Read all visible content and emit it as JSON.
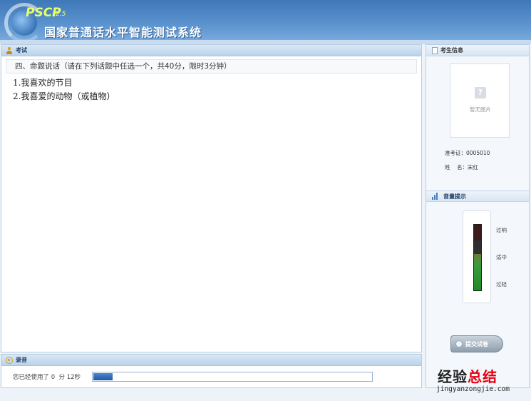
{
  "header": {
    "logo": "PSCP",
    "logo_version": "2.5",
    "title": "国家普通话水平智能测试系统"
  },
  "exam": {
    "tab_label": "考试",
    "section_title": "四、命题说话（请在下列话题中任选一个，共40分，限时3分钟）",
    "topics": [
      "1.我喜欢的节目",
      "2.我喜爱的动物（或植物）"
    ]
  },
  "recording": {
    "tab_label": "录音",
    "elapsed_text": "您已经使用了 0  分 12秒",
    "progress": 0.07
  },
  "candidate": {
    "tab_label": "考生信息",
    "photo_caption": "暂无图片",
    "exam_id_text": "准考证：0005010",
    "name_text": "姓    名：宋红"
  },
  "volume": {
    "tab_label": "音量提示",
    "levels": [
      "过响",
      "适中",
      "过轻"
    ],
    "level": 0.55
  },
  "submit_label": "提交试卷",
  "watermark": {
    "main": "经验",
    "accent": "总结",
    "url": "jingyanzongjie.com"
  }
}
